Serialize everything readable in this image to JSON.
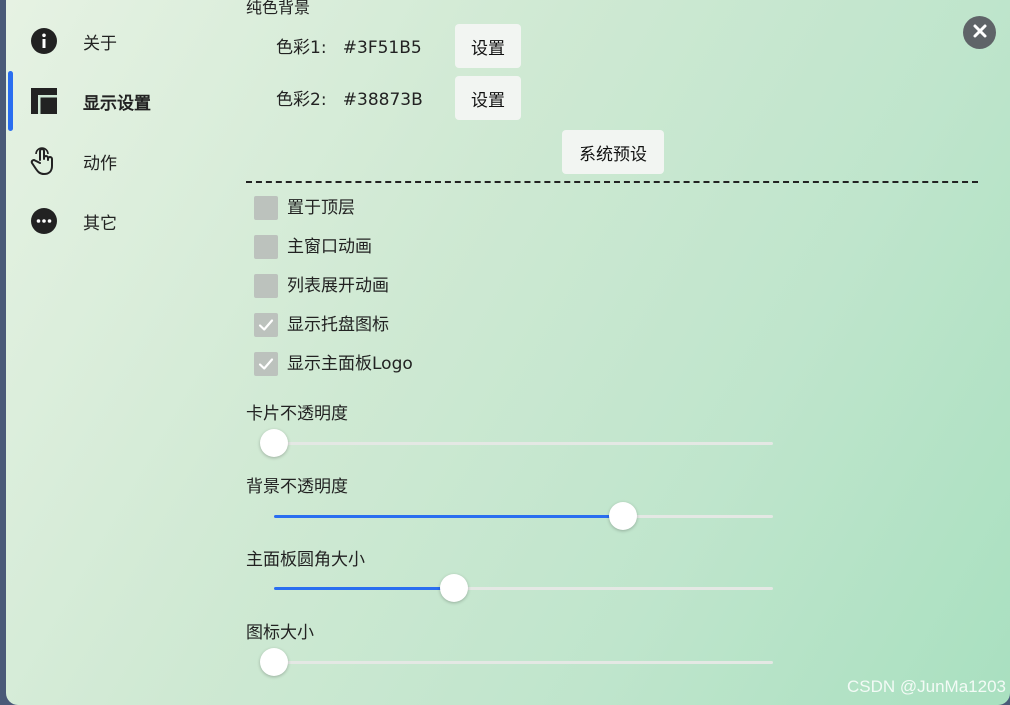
{
  "sidebar": {
    "items": [
      {
        "label": "关于",
        "icon": "info-icon"
      },
      {
        "label": "显示设置",
        "icon": "layout-icon",
        "active": true
      },
      {
        "label": "动作",
        "icon": "hand-pointer-icon"
      },
      {
        "label": "其它",
        "icon": "more-icon"
      }
    ],
    "accent": "#2a6ef0"
  },
  "background": {
    "section_title": "纯色背景",
    "color1": {
      "label": "色彩1:",
      "value": "#3F51B5",
      "button": "设置"
    },
    "color2": {
      "label": "色彩2:",
      "value": "#38873B",
      "button": "设置"
    },
    "preset_button": "系统预设"
  },
  "options": [
    {
      "label": "置于顶层",
      "checked": false
    },
    {
      "label": "主窗口动画",
      "checked": false
    },
    {
      "label": "列表展开动画",
      "checked": false
    },
    {
      "label": "显示托盘图标",
      "checked": true
    },
    {
      "label": "显示主面板Logo",
      "checked": true
    }
  ],
  "sliders": [
    {
      "label": "卡片不透明度",
      "value": 0.0
    },
    {
      "label": "背景不透明度",
      "value": 0.7
    },
    {
      "label": "主面板圆角大小",
      "value": 0.36
    },
    {
      "label": "图标大小",
      "value": 0.0
    }
  ],
  "watermark": "CSDN @JunMa1203"
}
